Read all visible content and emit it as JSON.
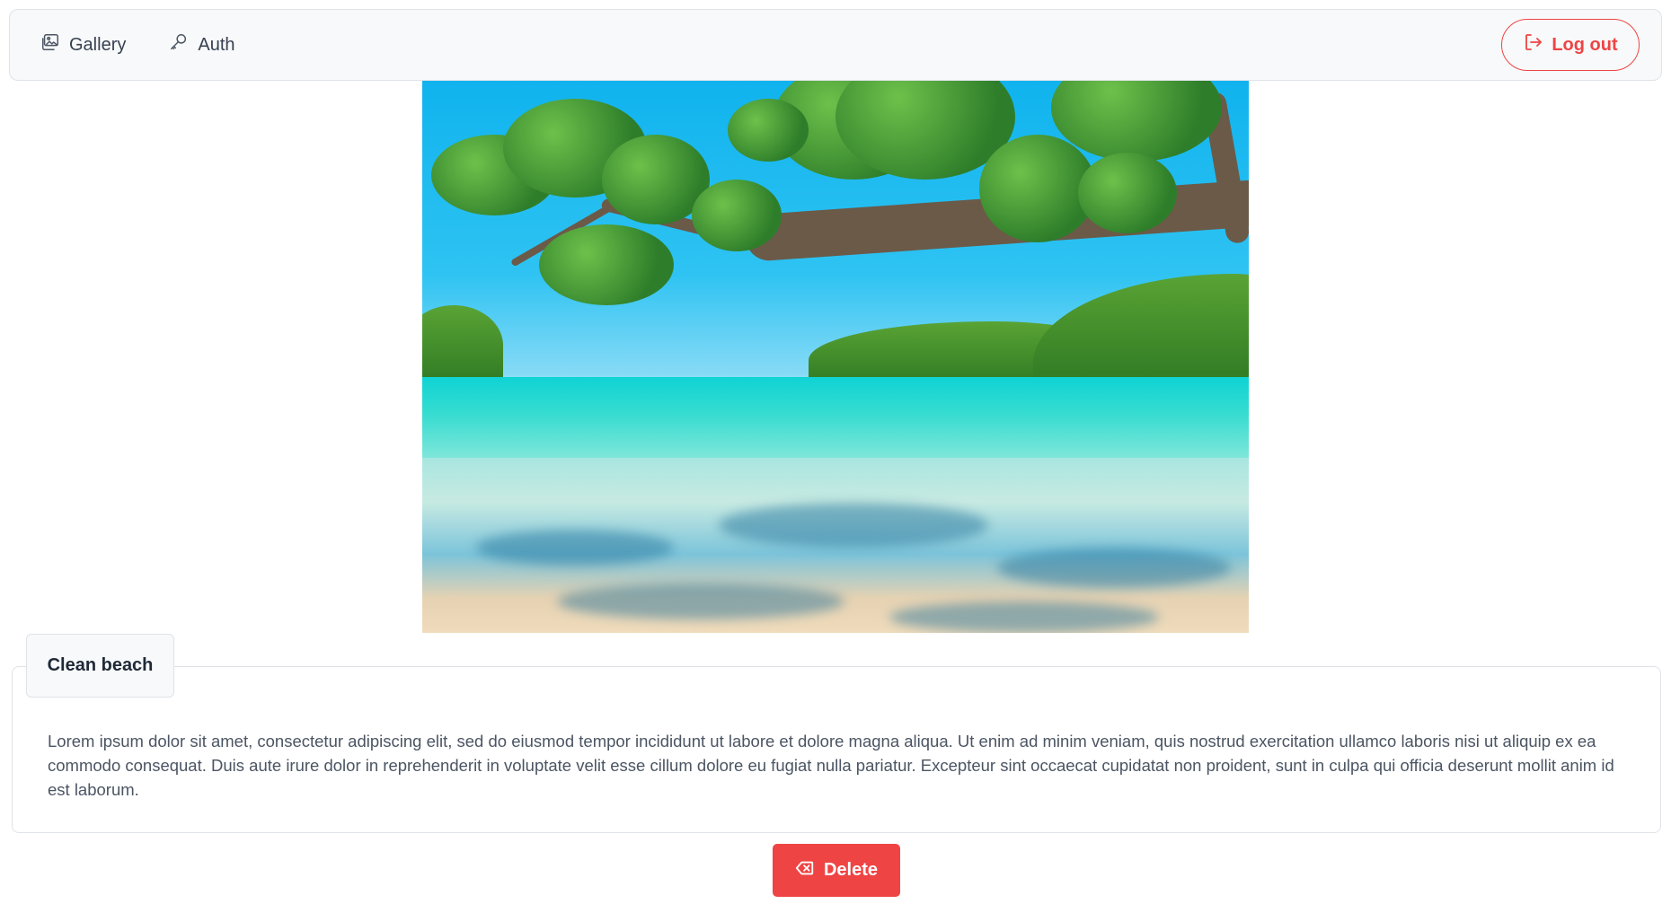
{
  "nav": {
    "items": [
      {
        "label": "Gallery",
        "icon": "images-icon"
      },
      {
        "label": "Auth",
        "icon": "key-icon"
      }
    ],
    "logout_label": "Log out"
  },
  "photo": {
    "subject": "tropical-beach-photo"
  },
  "card": {
    "title": "Clean beach",
    "description": "Lorem ipsum dolor sit amet, consectetur adipiscing elit, sed do eiusmod tempor incididunt ut labore et dolore magna aliqua. Ut enim ad minim veniam, quis nostrud exercitation ullamco laboris nisi ut aliquip ex ea commodo consequat. Duis aute irure dolor in reprehenderit in voluptate velit esse cillum dolore eu fugiat nulla pariatur. Excepteur sint occaecat cupidatat non proident, sunt in culpa qui officia deserunt mollit anim id est laborum."
  },
  "actions": {
    "delete_label": "Delete"
  },
  "colors": {
    "accent_danger": "#ef4444",
    "navbar_bg": "#f8f9fa",
    "border": "#dfe3e8"
  }
}
